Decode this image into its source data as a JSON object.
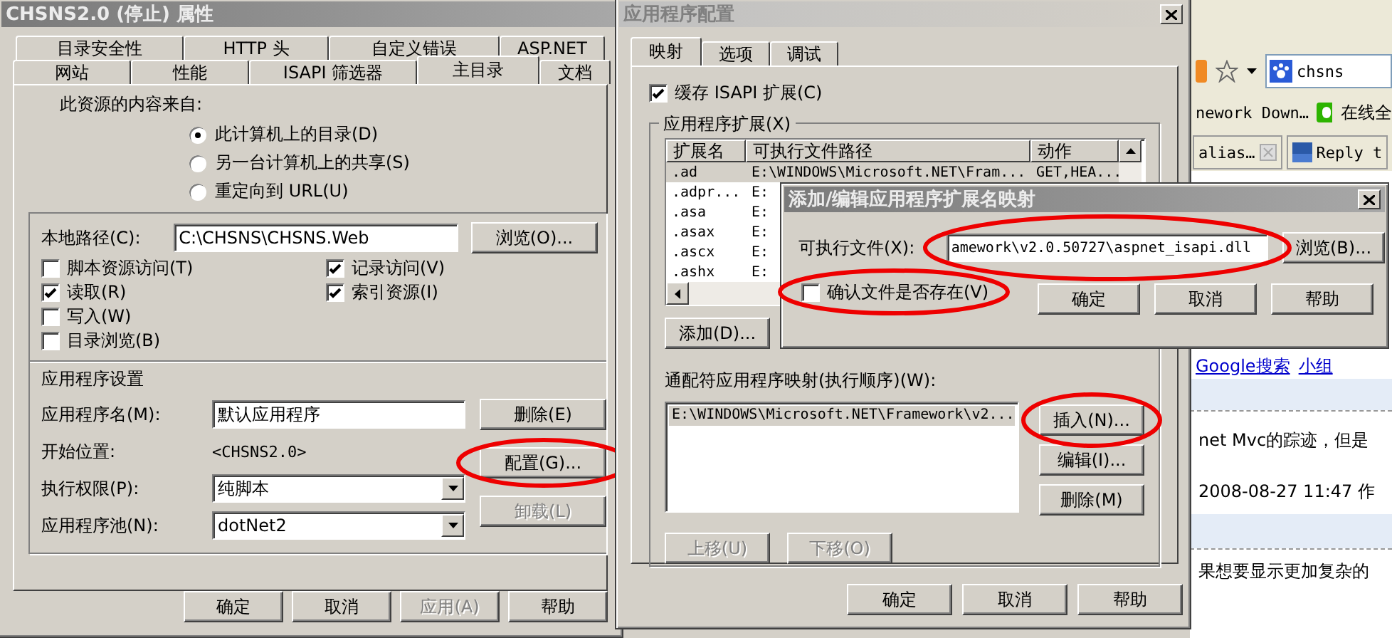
{
  "properties_window": {
    "title": "CHSNS2.0 (停止) 属性",
    "tabs_row_1": [
      {
        "label": "目录安全性",
        "selected": false
      },
      {
        "label": "HTTP 头",
        "selected": false
      },
      {
        "label": "自定义错误",
        "selected": false
      },
      {
        "label": "ASP.NET",
        "selected": false
      }
    ],
    "tabs_row_2": [
      {
        "label": "网站",
        "selected": false
      },
      {
        "label": "性能",
        "selected": false
      },
      {
        "label": "ISAPI 筛选器",
        "selected": false
      },
      {
        "label": "主目录",
        "selected": true
      },
      {
        "label": "文档",
        "selected": false
      }
    ],
    "content_source_label": "此资源的内容来自:",
    "source_options": [
      {
        "label": "此计算机上的目录(D)",
        "selected": true
      },
      {
        "label": "另一台计算机上的共享(S)",
        "selected": false
      },
      {
        "label": "重定向到 URL(U)",
        "selected": false
      }
    ],
    "local_path": {
      "label": "本地路径(C):",
      "value": "C:\\CHSNS\\CHSNS.Web"
    },
    "browse_button": "浏览(O)...",
    "permissions_left": [
      {
        "label": "脚本资源访问(T)",
        "checked": false
      },
      {
        "label": "读取(R)",
        "checked": true
      },
      {
        "label": "写入(W)",
        "checked": false
      },
      {
        "label": "目录浏览(B)",
        "checked": false
      }
    ],
    "permissions_right": [
      {
        "label": "记录访问(V)",
        "checked": true
      },
      {
        "label": "索引资源(I)",
        "checked": true
      }
    ],
    "app_settings_label": "应用程序设置",
    "app_name": {
      "label": "应用程序名(M):",
      "value": "默认应用程序"
    },
    "start_point": {
      "label": "开始位置:",
      "value": "<CHSNS2.0>"
    },
    "exec_permission": {
      "label": "执行权限(P):",
      "value": "纯脚本"
    },
    "app_pool": {
      "label": "应用程序池(N):",
      "value": "dotNet2"
    },
    "side_buttons": [
      {
        "label": "删除(E)",
        "disabled": false
      },
      {
        "label": "配置(G)...",
        "disabled": false
      },
      {
        "label": "卸载(L)",
        "disabled": true
      }
    ],
    "buttons": [
      {
        "label": "确定",
        "disabled": false
      },
      {
        "label": "取消",
        "disabled": false
      },
      {
        "label": "应用(A)",
        "disabled": true
      },
      {
        "label": "帮助",
        "disabled": false
      }
    ]
  },
  "config_window": {
    "title": "应用程序配置",
    "tabs": [
      {
        "label": "映射",
        "selected": true
      },
      {
        "label": "选项",
        "selected": false
      },
      {
        "label": "调试",
        "selected": false
      }
    ],
    "cache_isapi": {
      "label": "缓存 ISAPI 扩展(C)",
      "checked": true
    },
    "extensions_label": "应用程序扩展(X)",
    "columns": [
      "扩展名",
      "可执行文件路径",
      "动作"
    ],
    "rows": [
      {
        "cells": [
          ".ad",
          "E:\\WINDOWS\\Microsoft.NET\\Fram...",
          "GET,HEA..."
        ],
        "selected": true
      },
      {
        "cells": [
          ".adpr...",
          "E:"
        ],
        "selected": false
      },
      {
        "cells": [
          ".asa",
          "E:"
        ],
        "selected": false
      },
      {
        "cells": [
          ".asax",
          "E:"
        ],
        "selected": false
      },
      {
        "cells": [
          ".ascx",
          "E:"
        ],
        "selected": false
      },
      {
        "cells": [
          ".ashx",
          "E:"
        ],
        "selected": false
      }
    ],
    "add_button": "添加(D)...",
    "wildcard_label": "通配符应用程序映射(执行顺序)(W):",
    "wildcard_items": [
      {
        "text": "E:\\WINDOWS\\Microsoft.NET\\Framework\\v2...",
        "selected": true
      }
    ],
    "wildcard_buttons": [
      {
        "label": "插入(N)...",
        "disabled": false
      },
      {
        "label": "编辑(I)...",
        "disabled": false
      },
      {
        "label": "删除(M)",
        "disabled": false
      }
    ],
    "move_buttons": [
      {
        "label": "上移(U)",
        "disabled": true
      },
      {
        "label": "下移(O)",
        "disabled": true
      }
    ],
    "buttons": [
      {
        "label": "确定",
        "disabled": false
      },
      {
        "label": "取消",
        "disabled": false
      },
      {
        "label": "帮助",
        "disabled": false
      }
    ]
  },
  "mapping_dialog": {
    "title": "添加/编辑应用程序扩展名映射",
    "executable": {
      "label": "可执行文件(X):",
      "value": "amework\\v2.0.50727\\aspnet_isapi.dll"
    },
    "browse_button": "浏览(B)...",
    "verify_file": {
      "label": "确认文件是否存在(V)",
      "checked": false
    },
    "buttons": [
      {
        "label": "确定",
        "disabled": false
      },
      {
        "label": "取消",
        "disabled": false
      },
      {
        "label": "帮助",
        "disabled": false
      }
    ]
  },
  "browser": {
    "search_value": "chsns",
    "bookmarks": [
      "nework Down…",
      "在线全"
    ],
    "tabs": [
      "alias…",
      "Reply t"
    ],
    "links": [
      "Google搜索",
      "小组"
    ],
    "post_text": "net Mvc的踪迹，但是",
    "post_meta": "2008-08-27 11:47 作",
    "post_text_2": "果想要显示更加复杂的"
  }
}
